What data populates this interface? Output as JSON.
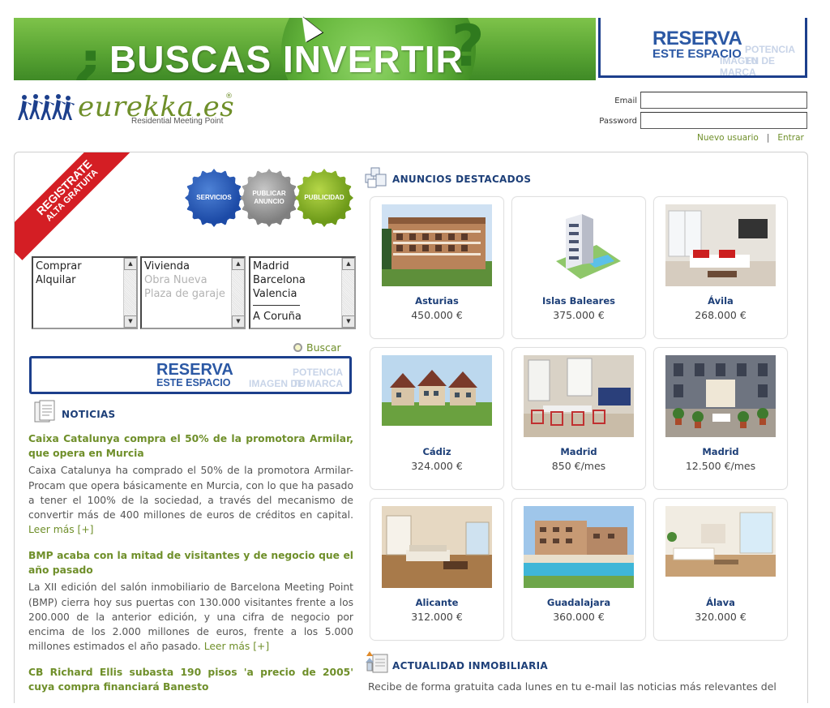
{
  "top_banner": {
    "headline": "¿BUSCAS INVERTIR?",
    "headline_inner": "BUSCAS INVERTIR",
    "open_q": "¿",
    "close_q": "?",
    "bg_color": "#5aa534"
  },
  "reserve_banner": {
    "line1": "RESERVA",
    "line2": "ESTE ESPACIO",
    "ghost1": "POTENCIA TU",
    "ghost2": "IMAGEN DE MARCA",
    "color": "#2b58a4"
  },
  "logo": {
    "name": "eurekka.es",
    "registered": "®",
    "tagline": "Residential Meeting Point"
  },
  "login": {
    "email_label": "Email",
    "password_label": "Password",
    "email_value": "",
    "password_value": "",
    "new_user": "Nuevo usuario",
    "separator": "|",
    "enter": "Entrar"
  },
  "ribbon": {
    "line1": "REGISTRATE",
    "line2": "ALTA GRATUITA"
  },
  "badges": {
    "servicios": "SERVICIOS",
    "publicar_1": "PUBLICAR",
    "publicar_2": "ANUNCIO",
    "publicidad": "PUBLICIDAD"
  },
  "search": {
    "operation_options": [
      "Comprar",
      "Alquilar"
    ],
    "type_options": [
      {
        "label": "Vivienda",
        "disabled": false
      },
      {
        "label": "Obra Nueva",
        "disabled": true
      },
      {
        "label": "Plaza de garaje",
        "disabled": true
      }
    ],
    "city_top": [
      "Madrid",
      "Barcelona",
      "Valencia"
    ],
    "city_after_separator": [
      "A Coruña"
    ],
    "button": "Buscar"
  },
  "reserve_small": {
    "line1": "RESERVA",
    "line2": "ESTE ESPACIO",
    "ghost1": "POTENCIA TU",
    "ghost2": "IMAGEN DE MARCA"
  },
  "news": {
    "heading": "NOTICIAS",
    "items": [
      {
        "title": "Caixa Catalunya compra el 50% de la promotora Armilar, que opera en Murcia",
        "body": "Caixa Catalunya ha comprado el 50% de la promotora Armilar-Procam que opera básicamente en Murcia, con lo que ha pasado a tener el 100% de la sociedad, a través del mecanismo de convertir más de 400 millones de euros de créditos en capital.",
        "more": "Leer más [+]"
      },
      {
        "title": "BMP acaba con la mitad de visitantes y de negocio que el año pasado",
        "body": "La XII edición del salón inmobiliario de Barcelona Meeting Point (BMP) cierra hoy sus puertas con 130.000 visitantes frente a los 200.000 de la anterior edición, y una cifra de negocio por encima de los 2.000 millones de euros, frente a los 5.000 millones estimados el año pasado.",
        "more": "Leer más [+]"
      },
      {
        "title": "CB Richard Ellis subasta 190 pisos 'a precio de 2005' cuya compra financiará Banesto",
        "body": "",
        "more": ""
      }
    ]
  },
  "featured": {
    "heading": "ANUNCIOS DESTACADOS",
    "listings": [
      {
        "city": "Asturias",
        "price": "450.000 €",
        "photo": "apartment-building"
      },
      {
        "city": "Islas Baleares",
        "price": "375.000 €",
        "photo": "tower-render"
      },
      {
        "city": "Ávila",
        "price": "268.000 €",
        "photo": "living-room-red"
      },
      {
        "city": "Cádiz",
        "price": "324.000 €",
        "photo": "townhouses"
      },
      {
        "city": "Madrid",
        "price": "850 €/mes",
        "photo": "dining-room"
      },
      {
        "city": "Madrid",
        "price": "12.500 €/mes",
        "photo": "courtyard"
      },
      {
        "city": "Alicante",
        "price": "312.000 €",
        "photo": "living-room-wood"
      },
      {
        "city": "Guadalajara",
        "price": "360.000 €",
        "photo": "pool"
      },
      {
        "city": "Álava",
        "price": "320.000 €",
        "photo": "living-room-white"
      }
    ]
  },
  "actualidad": {
    "heading": "ACTUALIDAD INMOBILIARIA",
    "text": "Recibe de forma gratuita cada lunes en tu e-mail las noticias más relevantes del"
  },
  "colors": {
    "accent_green": "#6f8f2a",
    "navy": "#1d3f78",
    "ribbon_red": "#d41e24"
  }
}
